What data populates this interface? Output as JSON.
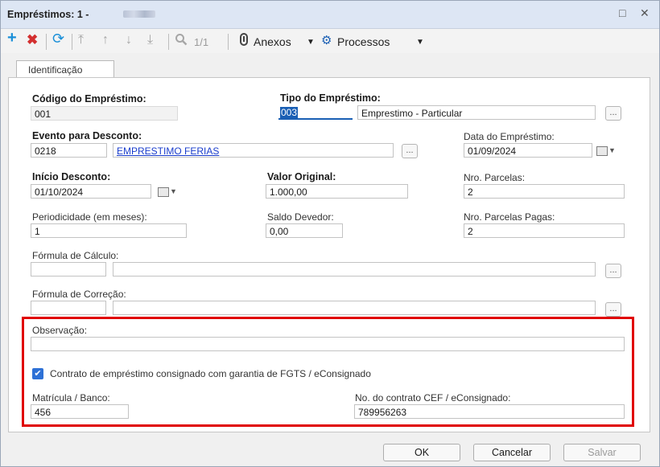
{
  "window": {
    "title": "Empréstimos: 1 -",
    "restore_glyph": "□",
    "close_glyph": "✕"
  },
  "toolbar": {
    "add_icon": "plus-icon",
    "delete_icon": "x-icon",
    "refresh_icon": "refresh-icon",
    "page_indicator": "1/1",
    "anexos_label": "Anexos",
    "processos_label": "Processos"
  },
  "tabs": [
    {
      "label": "Identificação"
    }
  ],
  "form": {
    "codigo": {
      "label": "Código do Empréstimo:",
      "value": "001"
    },
    "tipo": {
      "label": "Tipo do Empréstimo:",
      "code": "003",
      "description": "Emprestimo - Particular"
    },
    "evento": {
      "label": "Evento para Desconto:",
      "code": "0218",
      "description": "EMPRESTIMO FERIAS"
    },
    "data_emprestimo": {
      "label": "Data do Empréstimo:",
      "value": "01/09/2024"
    },
    "inicio_desconto": {
      "label": "Início Desconto:",
      "value": "01/10/2024"
    },
    "valor_original": {
      "label": "Valor Original:",
      "value": "1.000,00"
    },
    "nro_parcelas": {
      "label": "Nro. Parcelas:",
      "value": "2"
    },
    "periodicidade": {
      "label": "Periodicidade (em meses):",
      "value": "1"
    },
    "saldo_devedor": {
      "label": "Saldo Devedor:",
      "value": "0,00"
    },
    "parcelas_pagas": {
      "label": "Nro. Parcelas Pagas:",
      "value": "2"
    },
    "formula_calculo": {
      "label": "Fórmula de Cálculo:",
      "code": "",
      "description": ""
    },
    "formula_correcao": {
      "label": "Fórmula de Correção:",
      "code": "",
      "description": ""
    },
    "observacao": {
      "label": "Observação:",
      "value": ""
    },
    "consignado": {
      "label": "Contrato de empréstimo consignado com garantia de FGTS / eConsignado",
      "checked": true
    },
    "matricula": {
      "label": "Matrícula / Banco:",
      "value": "456"
    },
    "contrato_cef": {
      "label": "No. do contrato CEF / eConsignado:",
      "value": "789956263"
    },
    "lookup_glyph": "..."
  },
  "buttons": {
    "ok": "OK",
    "cancel": "Cancelar",
    "save": "Salvar"
  },
  "colors": {
    "accent": "#2e71d6",
    "add": "#1a8fd8",
    "delete": "#d32f2f",
    "highlight": "#e00000",
    "link": "#1a3dcc"
  }
}
